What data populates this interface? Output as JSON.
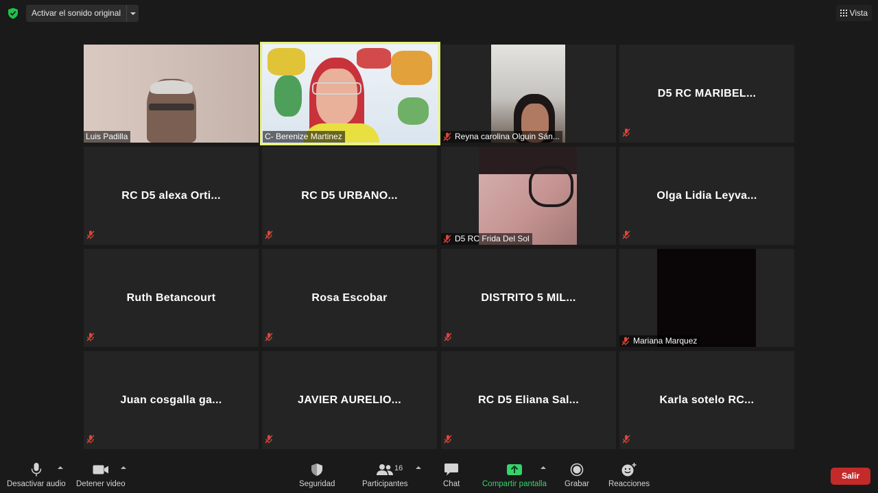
{
  "topbar": {
    "original_sound": "Activar el sonido original",
    "view": "Vista"
  },
  "tiles": {
    "luis": {
      "name": "Luis Padilla"
    },
    "berenize": {
      "name": "C- Berenize Martinez"
    },
    "reyna": {
      "name": "Reyna carolina Olguin Sán..."
    },
    "maribel": {
      "name": "D5  RC  MARIBEL..."
    },
    "alexa": {
      "name": "RC  D5  alexa  Orti..."
    },
    "urbano": {
      "name": "RC  D5  URBANO..."
    },
    "frida": {
      "name": "D5 RC Frida Del Sol"
    },
    "olga": {
      "name": "Olga  Lidia  Leyva..."
    },
    "ruth": {
      "name": "Ruth  Betancourt"
    },
    "rosa": {
      "name": "Rosa  Escobar"
    },
    "distrito": {
      "name": "DISTRITO  5  MIL..."
    },
    "mariana": {
      "name": "Mariana Marquez"
    },
    "juan": {
      "name": "Juan  cosgalla  ga..."
    },
    "javier": {
      "name": "JAVIER  AURELIO..."
    },
    "eliana": {
      "name": "RC  D5  Eliana  Sal..."
    },
    "karla": {
      "name": "Karla  sotelo  RC..."
    }
  },
  "toolbar": {
    "mute_label": "Desactivar audio",
    "video_label": "Detener video",
    "security_label": "Seguridad",
    "participants_label": "Participantes",
    "participants_count": "16",
    "chat_label": "Chat",
    "share_label": "Compartir pantalla",
    "record_label": "Grabar",
    "reactions_label": "Reacciones",
    "leave_label": "Salir"
  },
  "colors": {
    "active_speaker": "#e7f27a",
    "share_green": "#36d36b",
    "leave_red": "#c42a2a",
    "muted_red": "#e0453a"
  },
  "icons": {
    "shield": "shield-check-icon",
    "view": "grid-icon",
    "muted": "mic-muted-icon"
  }
}
